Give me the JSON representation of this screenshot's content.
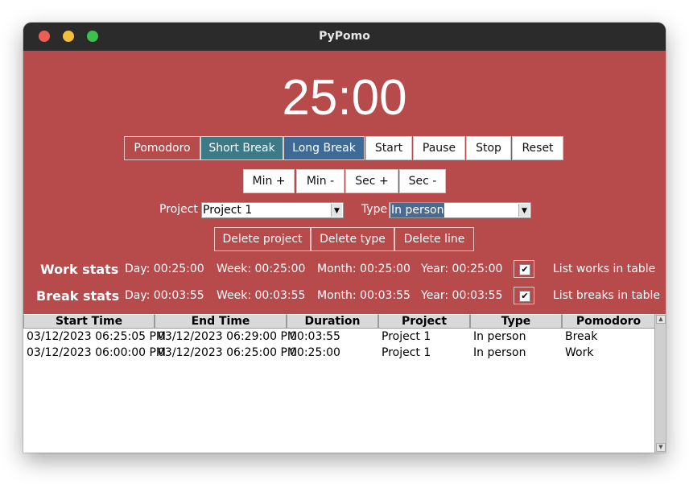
{
  "window": {
    "title": "PyPomo"
  },
  "timer": {
    "display": "25:00"
  },
  "mode_buttons": {
    "pomodoro": "Pomodoro",
    "short_break": "Short Break",
    "long_break": "Long Break"
  },
  "control_buttons": {
    "start": "Start",
    "pause": "Pause",
    "stop": "Stop",
    "reset": "Reset"
  },
  "adjust_buttons": {
    "min_plus": "Min +",
    "min_minus": "Min -",
    "sec_plus": "Sec +",
    "sec_minus": "Sec -"
  },
  "project": {
    "label": "Project",
    "value": "Project 1"
  },
  "type": {
    "label": "Type",
    "value": "In person"
  },
  "delete_buttons": {
    "project": "Delete project",
    "type": "Delete type",
    "line": "Delete line"
  },
  "work_stats": {
    "label": "Work stats",
    "day": "Day: 00:25:00",
    "week": "Week: 00:25:00",
    "month": "Month: 00:25:00",
    "year": "Year: 00:25:00",
    "checkbox_label": "List works in table",
    "checked": true
  },
  "break_stats": {
    "label": "Break stats",
    "day": "Day: 00:03:55",
    "week": "Week: 00:03:55",
    "month": "Month: 00:03:55",
    "year": "Year: 00:03:55",
    "checkbox_label": "List breaks in table",
    "checked": true
  },
  "table": {
    "headers": [
      "Start Time",
      "End Time",
      "Duration",
      "Project",
      "Type",
      "Pomodoro"
    ],
    "rows": [
      [
        "03/12/2023 06:25:05 PM",
        "03/12/2023 06:29:00 PM",
        "00:03:55",
        "Project 1",
        "In person",
        "Break"
      ],
      [
        "03/12/2023 06:00:00 PM",
        "03/12/2023 06:25:00 PM",
        "00:25:00",
        "Project 1",
        "In person",
        "Work"
      ]
    ]
  },
  "colors": {
    "background": "#b74a4b",
    "titlebar": "#2b2b2b",
    "short_break": "#3c7a87",
    "long_break": "#3e6b96"
  },
  "icons": {
    "checkmark": "checkmark-icon",
    "dropdown": "chevron-down-icon",
    "scroll_up": "arrow-up-icon",
    "scroll_down": "arrow-down-icon"
  }
}
